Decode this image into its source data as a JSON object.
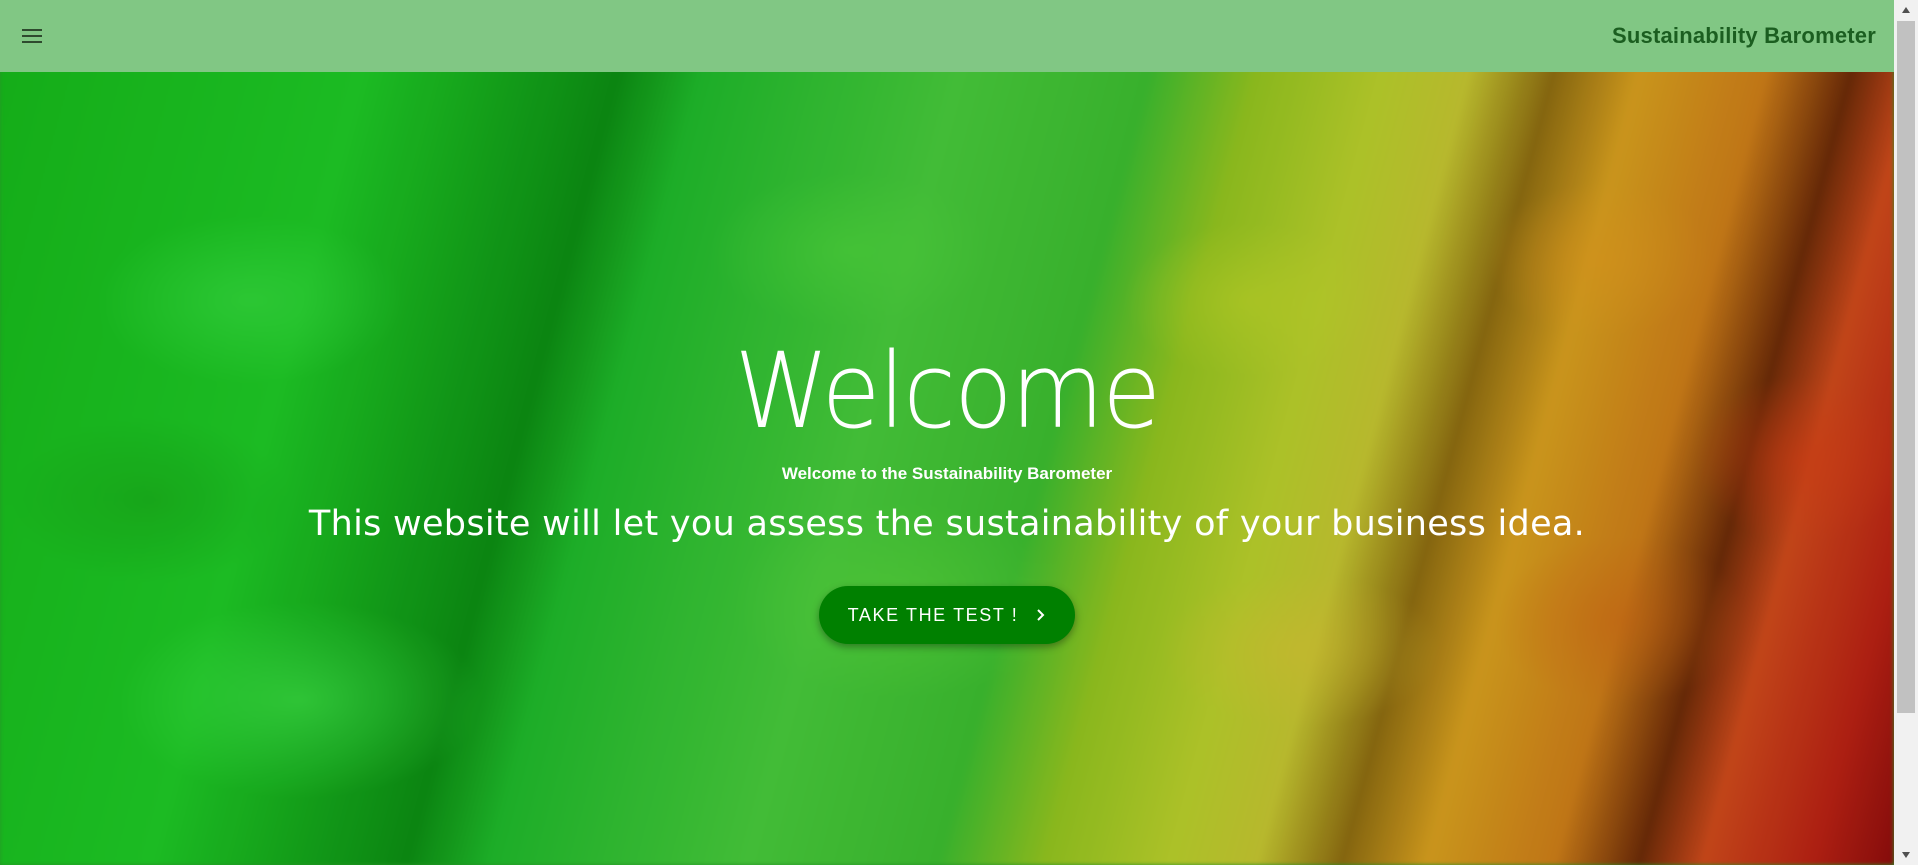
{
  "header": {
    "menu_icon": "hamburger-menu-icon",
    "title": "Sustainability Barometer",
    "background_color": "#81c784",
    "title_color": "#1b5e20"
  },
  "hero": {
    "heading": "Welcome",
    "subtitle": "Welcome to the Sustainability Barometer",
    "tagline": "This website will let you assess the sustainability of your business idea.",
    "cta_label": "TAKE THE TEST !",
    "cta_icon": "chevron-right-icon",
    "cta_color": "#008000"
  },
  "scrollbar": {
    "up_icon": "scroll-up-arrow-icon",
    "down_icon": "scroll-down-arrow-icon"
  }
}
